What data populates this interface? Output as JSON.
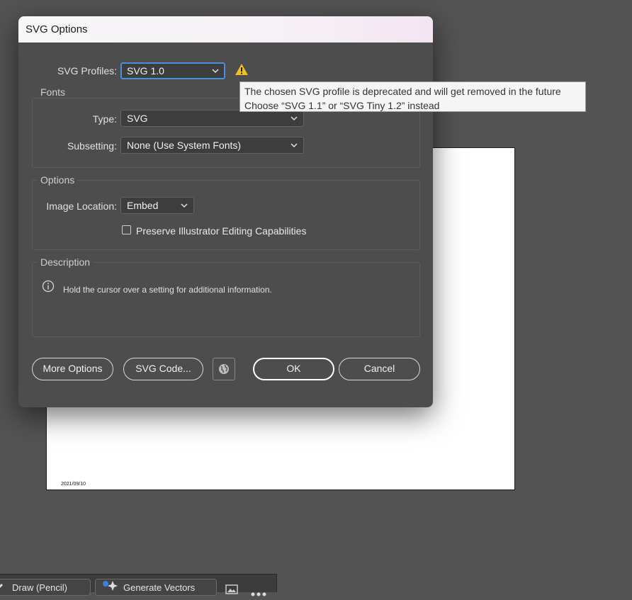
{
  "artboard": {
    "date_text": "2021/09/10"
  },
  "dialog": {
    "title": "SVG Options",
    "profiles": {
      "label": "SVG Profiles:",
      "value": "SVG 1.0"
    },
    "fonts": {
      "group_title": "Fonts",
      "type_label": "Type:",
      "type_value": "SVG",
      "subsetting_label": "Subsetting:",
      "subsetting_value": "None (Use System Fonts)"
    },
    "options": {
      "group_title": "Options",
      "image_location_label": "Image Location:",
      "image_location_value": "Embed",
      "preserve_label": "Preserve Illustrator Editing Capabilities",
      "preserve_checked": false
    },
    "description": {
      "group_title": "Description",
      "text": "Hold the cursor over a setting for additional information."
    },
    "buttons": {
      "more_options": "More Options",
      "svg_code": "SVG Code...",
      "ok": "OK",
      "cancel": "Cancel"
    }
  },
  "tooltip": {
    "line1": "The chosen SVG profile is deprecated and will get removed in the future",
    "line2": "Choose “SVG 1.1” or “SVG Tiny 1.2” instead"
  },
  "bottom_bar": {
    "draw_label": "Draw (Pencil)",
    "generate_label": "Generate Vectors"
  },
  "colors": {
    "accent_focus": "#4a90d9",
    "warning": "#f2c01e"
  }
}
